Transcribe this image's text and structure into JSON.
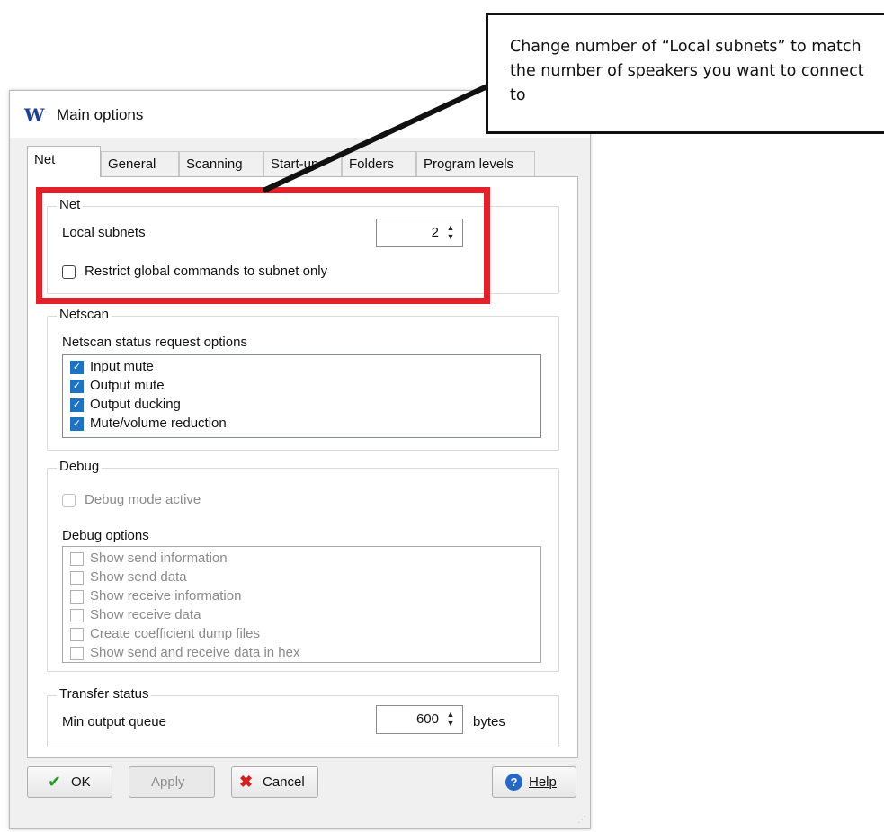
{
  "window": {
    "title": "Main options",
    "app_icon_letter": "W"
  },
  "tabs": [
    "Net",
    "General",
    "Scanning",
    "Start-up",
    "Folders",
    "Program levels"
  ],
  "net": {
    "group_title": "Net",
    "local_subnets_label": "Local subnets",
    "local_subnets_value": "2",
    "restrict_label": "Restrict global commands to subnet only",
    "restrict_checked": false
  },
  "netscan": {
    "group_title": "Netscan",
    "options_label": "Netscan status request options",
    "options": [
      {
        "label": "Input mute",
        "checked": true
      },
      {
        "label": "Output mute",
        "checked": true
      },
      {
        "label": "Output ducking",
        "checked": true
      },
      {
        "label": "Mute/volume reduction",
        "checked": true
      }
    ]
  },
  "debug": {
    "group_title": "Debug",
    "mode_label": "Debug mode active",
    "options_label": "Debug options",
    "options": [
      {
        "label": "Show send information",
        "checked": false
      },
      {
        "label": "Show send data",
        "checked": false
      },
      {
        "label": "Show receive information",
        "checked": false
      },
      {
        "label": "Show receive data",
        "checked": false
      },
      {
        "label": "Create coefficient dump files",
        "checked": false
      },
      {
        "label": "Show send and receive data in hex",
        "checked": false
      }
    ]
  },
  "transfer": {
    "group_title": "Transfer status",
    "min_queue_label": "Min output queue",
    "min_queue_value": "600",
    "unit": "bytes"
  },
  "buttons": {
    "ok": "OK",
    "apply": "Apply",
    "cancel": "Cancel",
    "help": "Help"
  },
  "annotation": {
    "text": "Change number of “Local subnets” to match the number of speakers you want to connect to",
    "highlight_color": "#e3212b"
  }
}
